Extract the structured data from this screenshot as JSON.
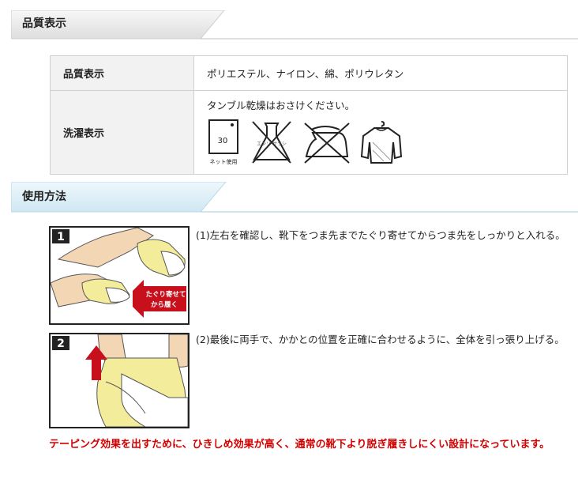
{
  "sections": {
    "quality_title": "品質表示",
    "usage_title": "使用方法"
  },
  "spec_table": {
    "material_label": "品質表示",
    "material_value": "ポリエステル、ナイロン、綿、ポリウレタン",
    "care_label": "洗濯表示",
    "care_note": "タンブル乾燥はおさけください。",
    "care_icons": [
      {
        "name": "wash-30-net-icon",
        "text": "30",
        "caption": "ネット使用"
      },
      {
        "name": "no-bleach-icon",
        "text": "エンソ サラシ"
      },
      {
        "name": "no-iron-icon"
      },
      {
        "name": "hang-dry-icon"
      }
    ]
  },
  "steps": [
    {
      "number": "1",
      "text": "(1)左右を確認し、靴下をつま先までたぐり寄せてからつま先をしっかりと入れる。",
      "arrow_label_1": "たぐり寄せて",
      "arrow_label_2": "から履く"
    },
    {
      "number": "2",
      "text": "(2)最後に両手で、かかとの位置を正確に合わせるように、全体を引っ張り上げる。"
    }
  ],
  "notice": "テーピング効果を出すために、ひきしめ効果が高く、通常の靴下より脱ぎ履きしにくい設計になっています。",
  "colors": {
    "header_tab": "#e8e8e8",
    "usage_tab": "#d7ecf5",
    "notice": "#d40000",
    "sock_yellow": "#f3ec9a",
    "arrow_red": "#c8101c"
  }
}
